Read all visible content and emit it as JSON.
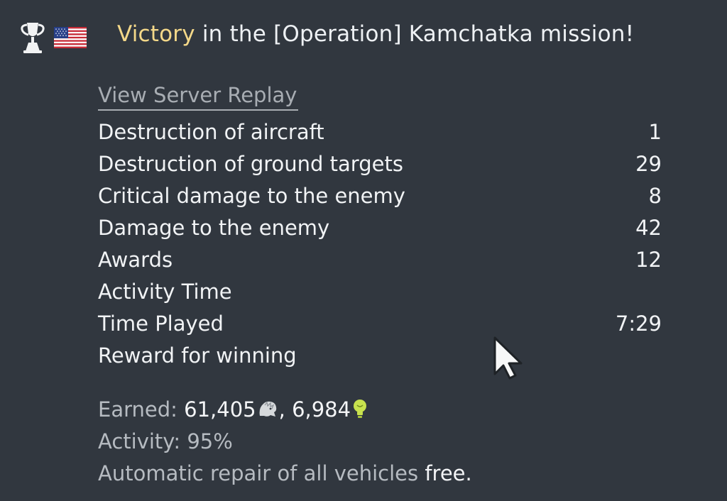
{
  "header": {
    "victory_word": "Victory",
    "mission_text": " in the [Operation] Kamchatka mission!",
    "trophy_icon": "trophy-icon",
    "flag_icon": "usa-flag-icon"
  },
  "replay_link": "View Server Replay",
  "stats": [
    {
      "label": "Destruction of aircraft",
      "value": "1"
    },
    {
      "label": "Destruction of ground targets",
      "value": "29"
    },
    {
      "label": "Critical damage to the enemy",
      "value": "8"
    },
    {
      "label": "Damage to the enemy",
      "value": "42"
    },
    {
      "label": "Awards",
      "value": "12"
    },
    {
      "label": "Activity Time",
      "value": ""
    },
    {
      "label": "Time Played",
      "value": "7:29"
    },
    {
      "label": "Reward for winning",
      "value": ""
    }
  ],
  "summary": {
    "earned_label": "Earned: ",
    "earned_silver": "61,405",
    "separator": ", ",
    "earned_research": "6,984",
    "activity_label": "Activity: ",
    "activity_value": "95%",
    "repair_label": "Automatic repair of all vehicles ",
    "repair_value": "free."
  },
  "colors": {
    "background": "#31373f",
    "victory": "#f4d889",
    "research_icon": "#c8e24e"
  }
}
